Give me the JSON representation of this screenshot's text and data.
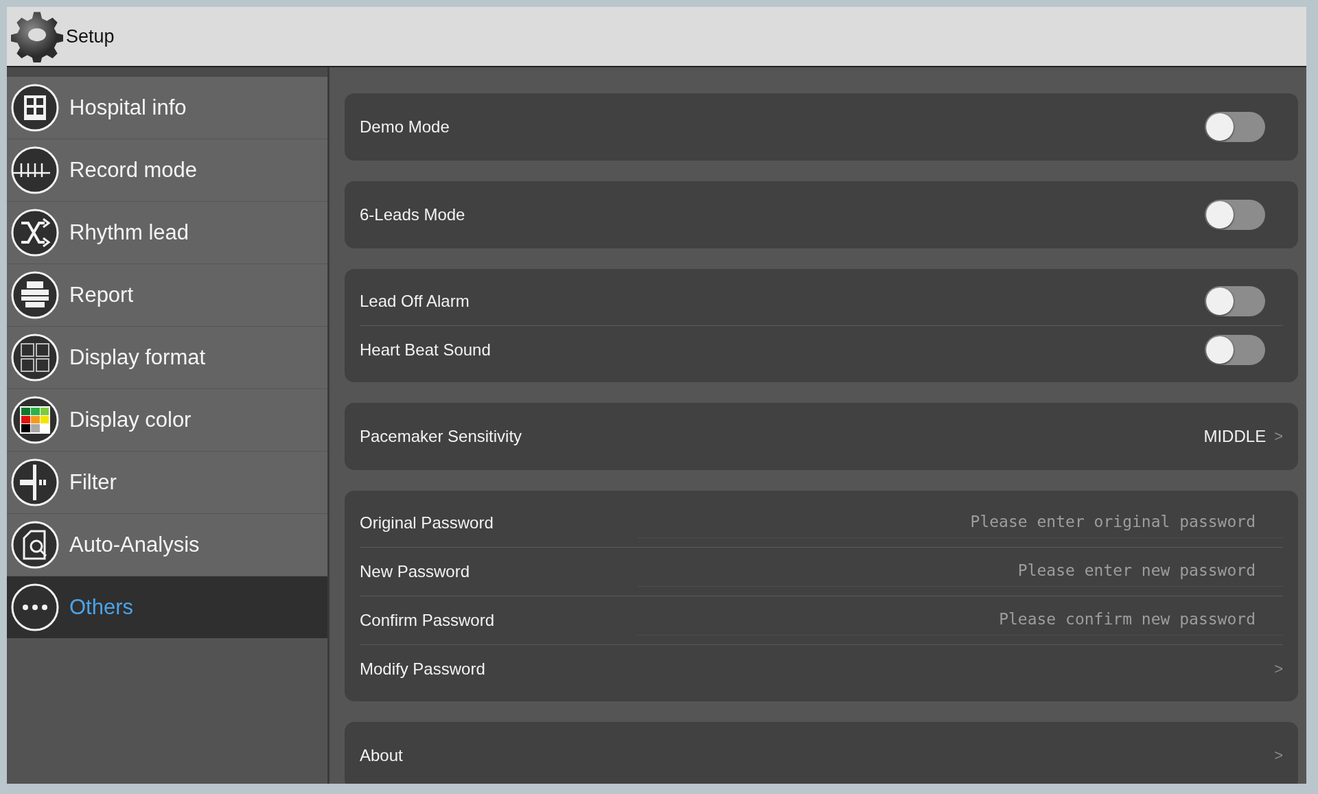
{
  "window": {
    "title": "Setup"
  },
  "sidebar": {
    "items": [
      {
        "label": "Hospital info",
        "selected": false
      },
      {
        "label": "Record mode",
        "selected": false
      },
      {
        "label": "Rhythm lead",
        "selected": false
      },
      {
        "label": "Report",
        "selected": false
      },
      {
        "label": "Display format",
        "selected": false
      },
      {
        "label": "Display color",
        "selected": false
      },
      {
        "label": "Filter",
        "selected": false
      },
      {
        "label": "Auto-Analysis",
        "selected": false
      },
      {
        "label": "Others",
        "selected": true
      }
    ]
  },
  "groups": [
    {
      "rows": [
        {
          "kind": "toggle",
          "label": "Demo Mode",
          "on": false
        }
      ]
    },
    {
      "rows": [
        {
          "kind": "toggle",
          "label": "6-Leads Mode",
          "on": false
        }
      ]
    },
    {
      "rows": [
        {
          "kind": "toggle",
          "label": "Lead Off Alarm",
          "on": false
        },
        {
          "kind": "toggle",
          "label": "Heart Beat Sound",
          "on": false
        }
      ]
    },
    {
      "rows": [
        {
          "kind": "value",
          "label": "Pacemaker Sensitivity",
          "value": "MIDDLE",
          "chevron": ">"
        }
      ]
    },
    {
      "rows": [
        {
          "kind": "password",
          "label": "Original Password",
          "placeholder": "Please enter original password"
        },
        {
          "kind": "password",
          "label": "New Password",
          "placeholder": "Please enter new password"
        },
        {
          "kind": "password",
          "label": "Confirm Password",
          "placeholder": "Please confirm new password"
        },
        {
          "kind": "link",
          "label": "Modify Password",
          "chevron": ">"
        }
      ]
    },
    {
      "rows": [
        {
          "kind": "link",
          "label": "About",
          "chevron": ">"
        }
      ]
    }
  ]
}
